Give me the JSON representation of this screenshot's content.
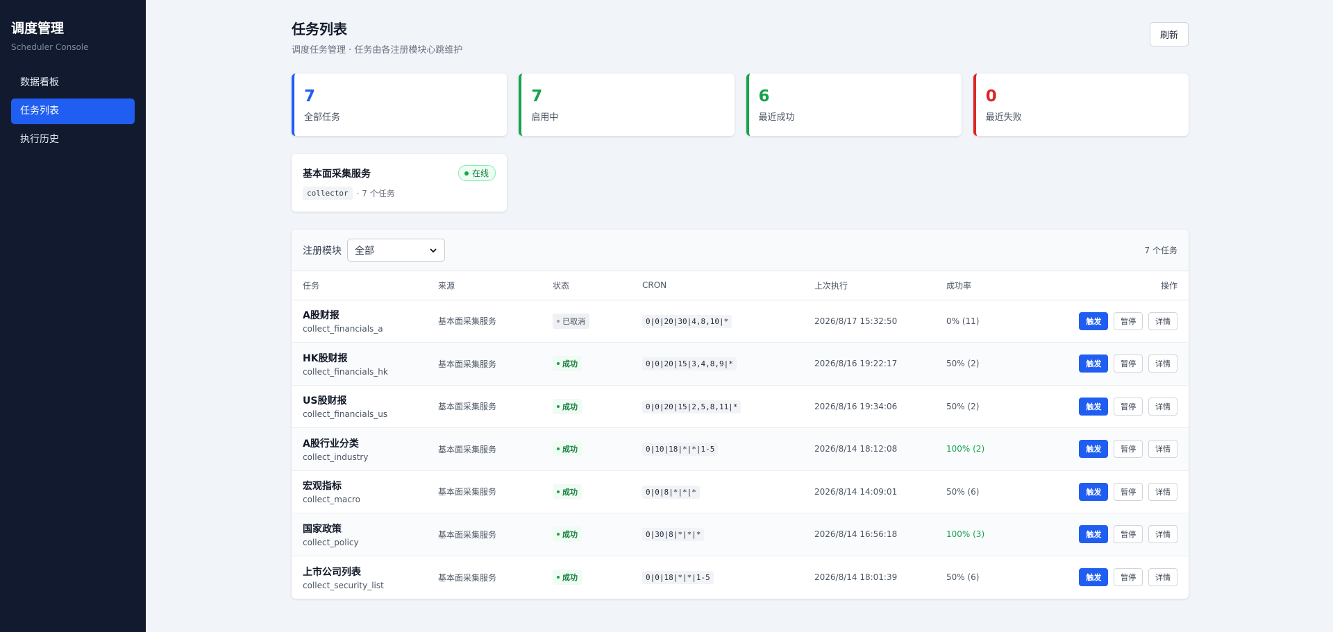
{
  "sidebar": {
    "title": "调度管理",
    "subtitle": "Scheduler Console",
    "items": [
      {
        "label": "数据看板",
        "active": false
      },
      {
        "label": "任务列表",
        "active": true
      },
      {
        "label": "执行历史",
        "active": false
      }
    ]
  },
  "header": {
    "title": "任务列表",
    "subtitle": "调度任务管理 · 任务由各注册模块心跳维护",
    "refresh_label": "刷新"
  },
  "stats": [
    {
      "value": "7",
      "label": "全部任务",
      "color": "#1f5ef0"
    },
    {
      "value": "7",
      "label": "启用中",
      "color": "#16a34a"
    },
    {
      "value": "6",
      "label": "最近成功",
      "color": "#16a34a"
    },
    {
      "value": "0",
      "label": "最近失败",
      "color": "#dc2626"
    }
  ],
  "module": {
    "name": "基本面采集服务",
    "status": "在线",
    "code": "collector",
    "meta": "· 7 个任务"
  },
  "filter": {
    "label": "注册模块",
    "selected": "全部",
    "count_text": "7 个任务"
  },
  "columns": {
    "task": "任务",
    "source": "来源",
    "status": "状态",
    "cron": "CRON",
    "last_run": "上次执行",
    "success_rate": "成功率",
    "actions": "操作"
  },
  "actions": {
    "trigger": "触发",
    "pause": "暂停",
    "detail": "详情"
  },
  "tasks": [
    {
      "name": "A股财报",
      "id": "collect_financials_a",
      "source": "基本面采集服务",
      "status": "已取消",
      "status_type": "cancel",
      "cron": "0|0|20|30|4,8,10|*",
      "last_run": "2026/8/17 15:32:50",
      "rate": "0% (11)",
      "rate_good": false
    },
    {
      "name": "HK股财报",
      "id": "collect_financials_hk",
      "source": "基本面采集服务",
      "status": "成功",
      "status_type": "ok",
      "cron": "0|0|20|15|3,4,8,9|*",
      "last_run": "2026/8/16 19:22:17",
      "rate": "50% (2)",
      "rate_good": false
    },
    {
      "name": "US股财报",
      "id": "collect_financials_us",
      "source": "基本面采集服务",
      "status": "成功",
      "status_type": "ok",
      "cron": "0|0|20|15|2,5,8,11|*",
      "last_run": "2026/8/16 19:34:06",
      "rate": "50% (2)",
      "rate_good": false
    },
    {
      "name": "A股行业分类",
      "id": "collect_industry",
      "source": "基本面采集服务",
      "status": "成功",
      "status_type": "ok",
      "cron": "0|10|18|*|*|1-5",
      "last_run": "2026/8/14 18:12:08",
      "rate": "100% (2)",
      "rate_good": true
    },
    {
      "name": "宏观指标",
      "id": "collect_macro",
      "source": "基本面采集服务",
      "status": "成功",
      "status_type": "ok",
      "cron": "0|0|8|*|*|*",
      "last_run": "2026/8/14 14:09:01",
      "rate": "50% (6)",
      "rate_good": false
    },
    {
      "name": "国家政策",
      "id": "collect_policy",
      "source": "基本面采集服务",
      "status": "成功",
      "status_type": "ok",
      "cron": "0|30|8|*|*|*",
      "last_run": "2026/8/14 16:56:18",
      "rate": "100% (3)",
      "rate_good": true
    },
    {
      "name": "上市公司列表",
      "id": "collect_security_list",
      "source": "基本面采集服务",
      "status": "成功",
      "status_type": "ok",
      "cron": "0|0|18|*|*|1-5",
      "last_run": "2026/8/14 18:01:39",
      "rate": "50% (6)",
      "rate_good": false
    }
  ]
}
